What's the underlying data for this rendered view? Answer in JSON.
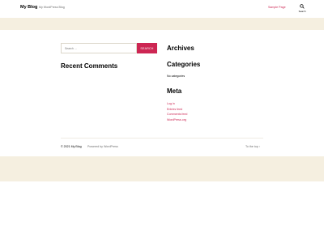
{
  "header": {
    "site_title": "My Blog",
    "site_description": "My WordPress Blog",
    "nav_items": [
      "Sample Page"
    ],
    "search_toggle_label": "Search"
  },
  "search": {
    "placeholder": "Search …",
    "submit_label": "SEARCH"
  },
  "widgets": {
    "recent_comments_title": "Recent Comments",
    "archives_title": "Archives",
    "categories_title": "Categories",
    "categories_empty": "No categories",
    "meta_title": "Meta",
    "meta_links": [
      "Log in",
      "Entries feed",
      "Comments feed",
      "WordPress.org"
    ]
  },
  "footer": {
    "copyright": "© 2021 My Blog",
    "powered_by": "Powered by WordPress",
    "to_top": "To the top ↑"
  },
  "colors": {
    "accent": "#cd2653",
    "band_background": "#f5efe0"
  }
}
